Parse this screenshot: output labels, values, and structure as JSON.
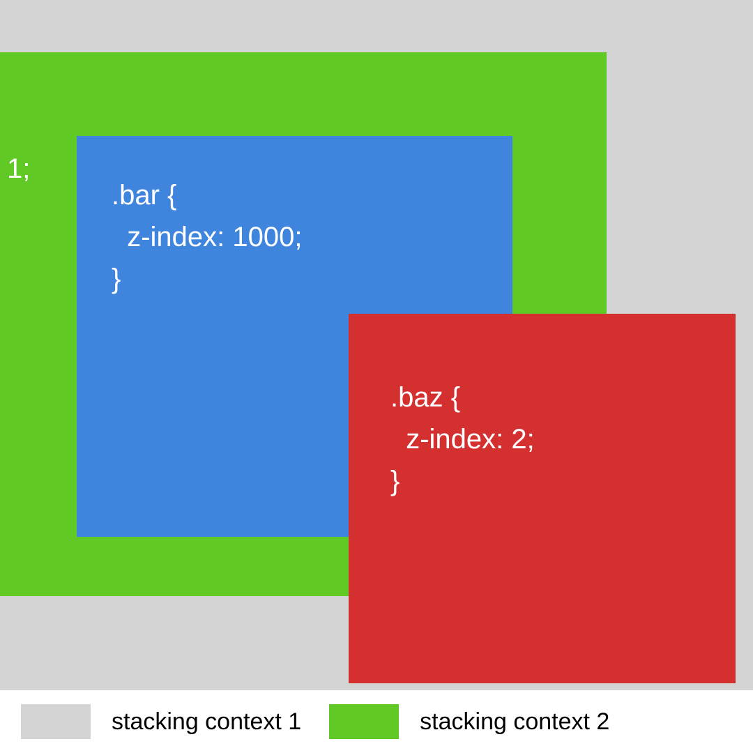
{
  "diagram": {
    "green_fragment": "1;",
    "bar_code": ".bar {\n  z-index: 1000;\n}",
    "baz_code": ".baz {\n  z-index: 2;\n}"
  },
  "legend": {
    "context1_label": "stacking context 1",
    "context2_label": "stacking context 2"
  },
  "colors": {
    "background": "#d4d4d4",
    "green": "#61c925",
    "blue": "#3f85dd",
    "red": "#d43030"
  }
}
